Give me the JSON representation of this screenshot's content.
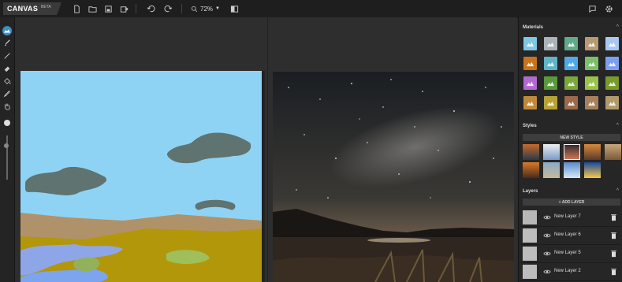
{
  "app": {
    "name": "CANVAS",
    "badge": "BETA"
  },
  "toolbar": {
    "zoom": "72%"
  },
  "panel": {
    "materials_title": "Materials",
    "styles_title": "Styles",
    "new_style_label": "NEW STYLE",
    "layers_title": "Layers",
    "add_layer_label": "+ ADD LAYER",
    "layers": [
      {
        "name": "New Layer 7"
      },
      {
        "name": "New Layer 6"
      },
      {
        "name": "New Layer 5"
      },
      {
        "name": "New Layer 2"
      }
    ]
  },
  "materials": [
    {
      "icon": "sky-icon",
      "color": "#7ec8e3"
    },
    {
      "icon": "cloud-icon",
      "color": "#a9b3b8"
    },
    {
      "icon": "mountain-icon",
      "color": "#5faa8a"
    },
    {
      "icon": "rock-mountain-icon",
      "color": "#b59a73"
    },
    {
      "icon": "snow-icon",
      "color": "#a9c8f0"
    },
    {
      "icon": "fire-icon",
      "color": "#c8741c"
    },
    {
      "icon": "hill-icon",
      "color": "#5fb4c8"
    },
    {
      "icon": "water-icon",
      "color": "#4fa8e8"
    },
    {
      "icon": "forest-icon",
      "color": "#7bbf6a"
    },
    {
      "icon": "river-icon",
      "color": "#7b9ef0"
    },
    {
      "icon": "flower-icon",
      "color": "#b36ad0"
    },
    {
      "icon": "grass-icon",
      "color": "#5a9a3c"
    },
    {
      "icon": "trees-icon",
      "color": "#7aa83a"
    },
    {
      "icon": "bush-icon",
      "color": "#9bc24a"
    },
    {
      "icon": "hedge-icon",
      "color": "#7a9a2a"
    },
    {
      "icon": "sand-icon",
      "color": "#c08a3a"
    },
    {
      "icon": "field-icon",
      "color": "#b8a232"
    },
    {
      "icon": "dirt-icon",
      "color": "#9a6a4a"
    },
    {
      "icon": "stone-icon",
      "color": "#a8805a"
    },
    {
      "icon": "building-icon",
      "color": "#b09a6a"
    }
  ]
}
